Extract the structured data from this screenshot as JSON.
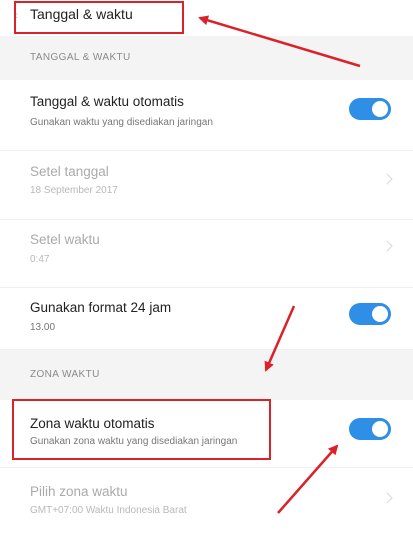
{
  "header": {
    "title": "Tanggal & waktu",
    "back_icon": "chevron-left-icon"
  },
  "sections": {
    "datetime": "TANGGAL & WAKTU",
    "timezone": "ZONA WAKTU"
  },
  "rows": {
    "auto_datetime": {
      "title": "Tanggal & waktu otomatis",
      "subtitle": "Gunakan waktu yang disediakan jaringan",
      "enabled": true
    },
    "set_date": {
      "title": "Setel tanggal",
      "subtitle": "18 September 2017"
    },
    "set_time": {
      "title": "Setel waktu",
      "subtitle": "0:47"
    },
    "format_24h": {
      "title": "Gunakan format 24 jam",
      "subtitle": "13.00",
      "enabled": true
    },
    "auto_timezone": {
      "title": "Zona waktu otomatis",
      "subtitle": "Gunakan zona waktu yang disediakan jaringan",
      "enabled": true
    },
    "pick_timezone": {
      "title": "Pilih zona waktu",
      "subtitle": "GMT+07:00 Waktu Indonesia Barat"
    }
  },
  "colors": {
    "accent": "#2f8ee6",
    "annotation": "#d9222a",
    "section_bg": "#f4f4f4"
  }
}
